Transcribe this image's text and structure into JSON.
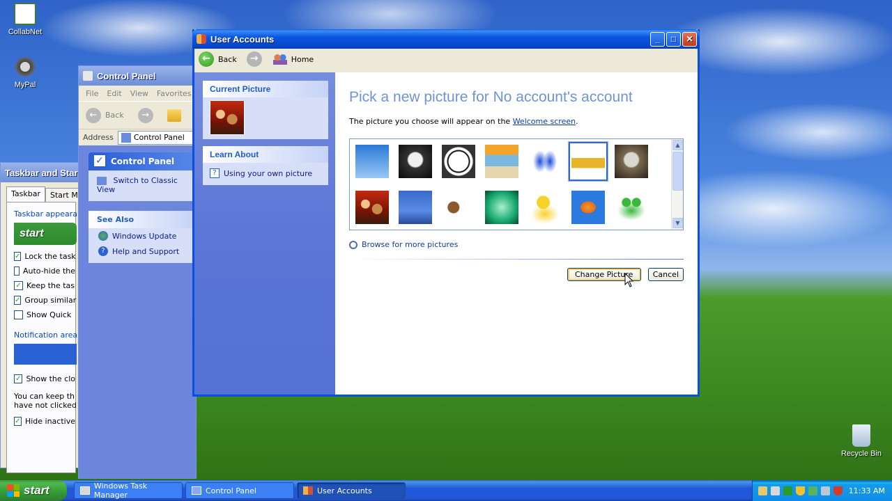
{
  "desktop": {
    "icons": [
      {
        "label": "CollabNet"
      },
      {
        "label": "MyPal"
      },
      {
        "label": "Recycle Bin"
      }
    ]
  },
  "taskbar_props": {
    "title": "Taskbar and Start",
    "tabs": [
      "Taskbar",
      "Start Me"
    ],
    "group1": "Taskbar appeara",
    "start_label": "start",
    "checks": [
      {
        "label": "Lock the task",
        "checked": true
      },
      {
        "label": "Auto-hide the",
        "checked": false
      },
      {
        "label": "Keep the tas",
        "checked": true
      },
      {
        "label": "Group similar",
        "checked": true
      },
      {
        "label": "Show Quick",
        "checked": false
      }
    ],
    "group2": "Notification area",
    "show_clock": "Show the clo",
    "note_line1": "You can keep th",
    "note_line2": "have not clicked",
    "hide_inactive": "Hide inactive"
  },
  "control_panel": {
    "title": "Control Panel",
    "menu": [
      "File",
      "Edit",
      "View",
      "Favorites"
    ],
    "back_label": "Back",
    "address_label": "Address",
    "address_value": "Control Panel",
    "panel_title": "Control Panel",
    "switch_link": "Switch to Classic View",
    "see_also_title": "See Also",
    "see_also": [
      "Windows Update",
      "Help and Support"
    ]
  },
  "user_accounts": {
    "title": "User Accounts",
    "nav": {
      "back": "Back",
      "home": "Home"
    },
    "current_picture_title": "Current Picture",
    "learn_about_title": "Learn About",
    "learn_link": "Using your own picture",
    "heading": "Pick a new picture for No account's account",
    "desc_prefix": "The picture you choose will appear on the",
    "desc_link": "Welcome screen",
    "desc_suffix": ".",
    "pictures": [
      "airplane",
      "astronaut",
      "soccer ball",
      "beach chairs",
      "butterfly",
      "car",
      "owl",
      "chess",
      "dirt bike",
      "dog",
      "drip",
      "duck",
      "fish",
      "frog"
    ],
    "selected_picture": "car",
    "browse": "Browse for more pictures",
    "change_btn": "Change Picture",
    "cancel_btn": "Cancel"
  },
  "taskbar": {
    "start": "start",
    "tasks": [
      "Windows Task Manager",
      "Control Panel",
      "User Accounts"
    ],
    "active_task": "User Accounts",
    "clock": "11:33 AM"
  }
}
